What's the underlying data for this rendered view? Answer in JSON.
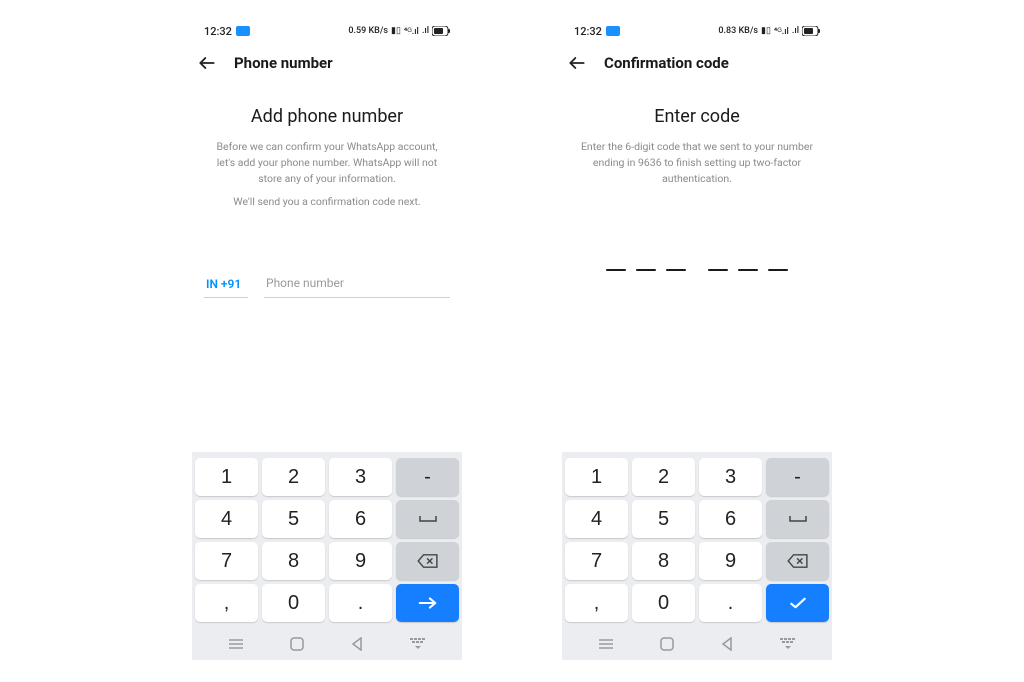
{
  "status": {
    "time": "12:32",
    "network": "0.59 KB/s",
    "network2": "0.83 KB/s",
    "signals": "⁴⁶ ₄₆ ᴴᴰ .ıl .ıl",
    "battery": "63"
  },
  "screen1": {
    "header_title": "Phone number",
    "main_title": "Add phone number",
    "desc1": "Before we can confirm your WhatsApp account, let's add your phone number. WhatsApp will not store any of your information.",
    "desc2": "We'll send you a confirmation code next.",
    "country_code": "IN +91",
    "phone_placeholder": "Phone number"
  },
  "screen2": {
    "header_title": "Confirmation code",
    "main_title": "Enter code",
    "desc1": "Enter the 6-digit code that we sent to your number ending in 9636 to finish setting up two-factor authentication."
  },
  "keypad": {
    "k1": "1",
    "k2": "2",
    "k3": "3",
    "dash": "-",
    "k4": "4",
    "k5": "5",
    "k6": "6",
    "space": "␣",
    "k7": "7",
    "k8": "8",
    "k9": "9",
    "comma": ",",
    "k0": "0",
    "dot": "."
  }
}
